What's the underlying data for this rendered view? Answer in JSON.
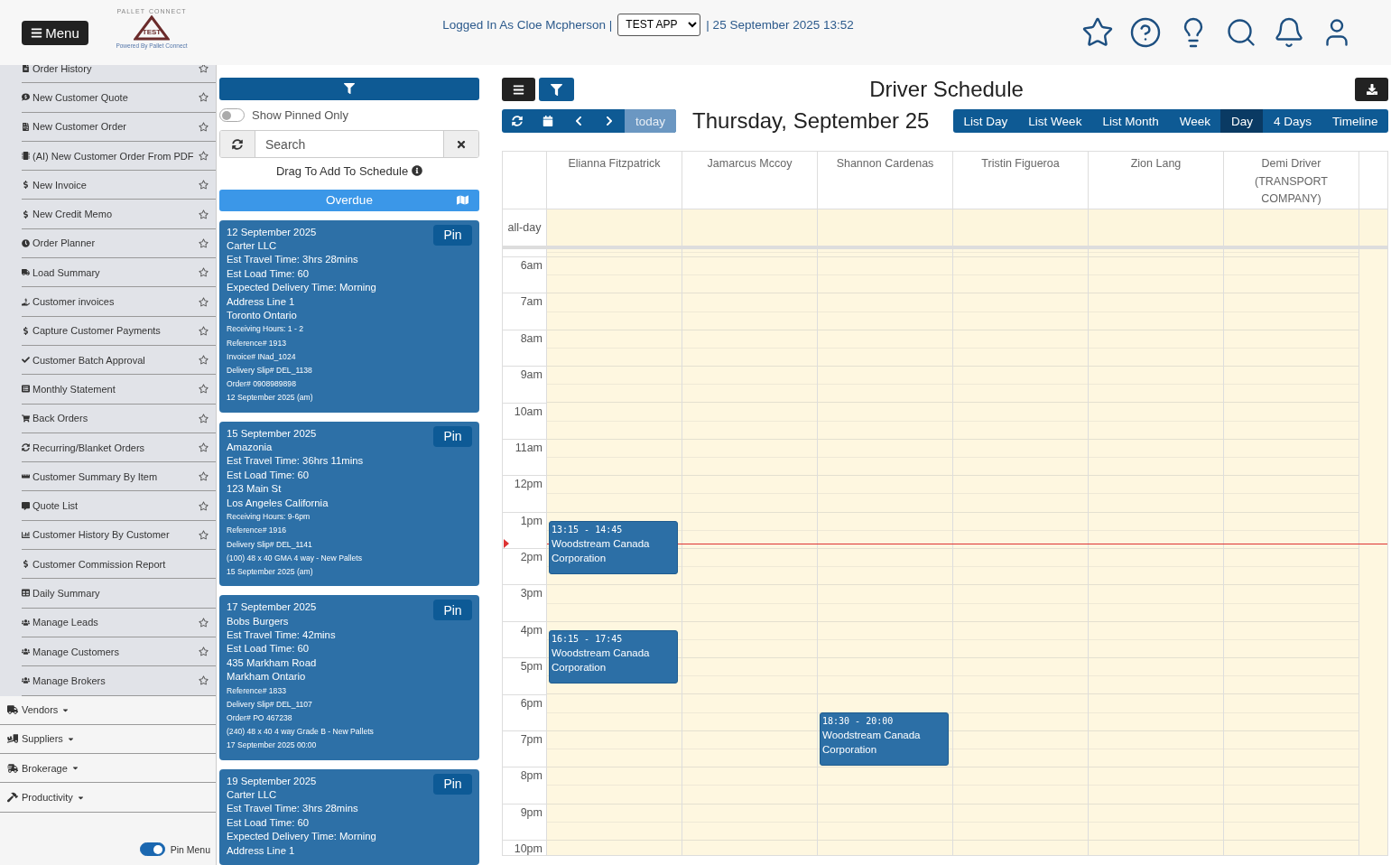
{
  "header": {
    "menu_button": "Menu",
    "logo": {
      "top": "PALLET",
      "bottom": "CONNECT",
      "badge": "TEST",
      "tagline": "Powered By Pallet Connect"
    },
    "user_text": "Logged In As Cloe Mcpherson |",
    "app_select": "TEST APP",
    "datetime": "| 25 September 2025 13:52"
  },
  "sidebar": {
    "items": [
      {
        "label": "Order History",
        "favorite": true
      },
      {
        "label": "New Customer Quote",
        "favorite": true
      },
      {
        "label": "New Customer Order",
        "favorite": true
      },
      {
        "label": "(AI) New Customer Order From PDF",
        "favorite": true
      },
      {
        "label": "New Invoice",
        "favorite": true
      },
      {
        "label": "New Credit Memo",
        "favorite": true
      },
      {
        "label": "Order Planner",
        "favorite": true
      },
      {
        "label": "Load Summary",
        "favorite": true
      },
      {
        "label": "Customer invoices",
        "favorite": true
      },
      {
        "label": "Capture Customer Payments",
        "favorite": true
      },
      {
        "label": "Customer Batch Approval",
        "favorite": true
      },
      {
        "label": "Monthly Statement",
        "favorite": true
      },
      {
        "label": "Back Orders",
        "favorite": true
      },
      {
        "label": "Recurring/Blanket Orders",
        "favorite": true
      },
      {
        "label": "Customer Summary By Item",
        "favorite": true
      },
      {
        "label": "Quote List",
        "favorite": true
      },
      {
        "label": "Customer History By Customer",
        "favorite": true
      },
      {
        "label": "Customer Commission Report",
        "favorite": false
      },
      {
        "label": "Daily Summary",
        "favorite": false
      },
      {
        "label": "Manage Leads",
        "favorite": true
      },
      {
        "label": "Manage Customers",
        "favorite": true
      },
      {
        "label": "Manage Brokers",
        "favorite": true
      }
    ],
    "groups": [
      {
        "label": "Vendors",
        "expanded": false
      },
      {
        "label": "Suppliers",
        "expanded": false
      },
      {
        "label": "Brokerage",
        "expanded": false
      },
      {
        "label": "Productivity",
        "expanded": false
      }
    ],
    "pin_menu": {
      "label": "Pin Menu",
      "on": true
    }
  },
  "orders_panel": {
    "show_pinned": {
      "label": "Show Pinned Only",
      "on": false
    },
    "search": {
      "placeholder": "Search"
    },
    "drag_hint": "Drag To Add To Schedule",
    "section": "Overdue",
    "cards": [
      {
        "pin": "Pin",
        "lines": [
          "12 September 2025",
          "Carter LLC",
          "Est Travel Time: 3hrs 28mins",
          "Est Load Time: 60",
          "Expected Delivery Time: Morning",
          "Address Line 1",
          "Toronto Ontario"
        ],
        "details": [
          "Receiving Hours: 1 - 2",
          "Reference# 1913",
          "Invoice# INad_1024",
          "Delivery Slip# DEL_1138",
          "Order# 0908989898",
          "12 September 2025 (am)"
        ]
      },
      {
        "pin": "Pin",
        "lines": [
          "15 September 2025",
          "Amazonia",
          "Est Travel Time: 36hrs 11mins",
          "Est Load Time: 60",
          "123 Main St",
          "Los Angeles California"
        ],
        "details": [
          "Receiving Hours: 9-6pm",
          "Reference# 1916",
          "Delivery Slip# DEL_1141",
          "(100) 48 x 40 GMA 4 way - New Pallets",
          "15 September 2025 (am)"
        ]
      },
      {
        "pin": "Pin",
        "lines": [
          "17 September 2025",
          "Bobs Burgers",
          "Est Travel Time: 42mins",
          "Est Load Time: 60",
          "435 Markham Road",
          "Markham Ontario"
        ],
        "details": [
          "Reference# 1833",
          "Delivery Slip# DEL_1107",
          "Order# PO 467238",
          "(240) 48 x 40 4 way Grade B - New Pallets",
          "17 September 2025 00:00"
        ]
      },
      {
        "pin": "Pin",
        "lines": [
          "19 September 2025",
          "Carter LLC",
          "Est Travel Time: 3hrs 28mins",
          "Est Load Time: 60",
          "Expected Delivery Time: Morning",
          "Address Line 1"
        ]
      }
    ]
  },
  "calendar": {
    "title": "Driver Schedule",
    "date_title": "Thursday, September 25",
    "today": "today",
    "views": [
      {
        "label": "List Day",
        "selected": false
      },
      {
        "label": "List Week",
        "selected": false
      },
      {
        "label": "List Month",
        "selected": false
      },
      {
        "label": "Week",
        "selected": false
      },
      {
        "label": "Day",
        "selected": true
      },
      {
        "label": "4 Days",
        "selected": false
      },
      {
        "label": "Timeline",
        "selected": false
      }
    ],
    "all_day": "all-day",
    "hours": [
      "6am",
      "7am",
      "8am",
      "9am",
      "10am",
      "11am",
      "12pm",
      "1pm",
      "2pm",
      "3pm",
      "4pm",
      "5pm",
      "6pm",
      "7pm",
      "8pm",
      "9pm",
      "10pm"
    ],
    "columns": [
      {
        "name": "Elianna Fitzpatrick",
        "events": [
          {
            "time": "13:15 - 14:45",
            "title": "Woodstream Canada Corporation"
          },
          {
            "time": "16:15 - 17:45",
            "title": "Woodstream Canada Corporation"
          }
        ]
      },
      {
        "name": "Jamarcus Mccoy"
      },
      {
        "name": "Shannon Cardenas",
        "events": [
          {
            "time": "18:30 - 20:00",
            "title": "Woodstream Canada Corporation"
          }
        ]
      },
      {
        "name": "Tristin Figueroa"
      },
      {
        "name": "Zion Lang"
      },
      {
        "name": "Demi Driver (TRANSPORT COMPANY)"
      }
    ]
  }
}
